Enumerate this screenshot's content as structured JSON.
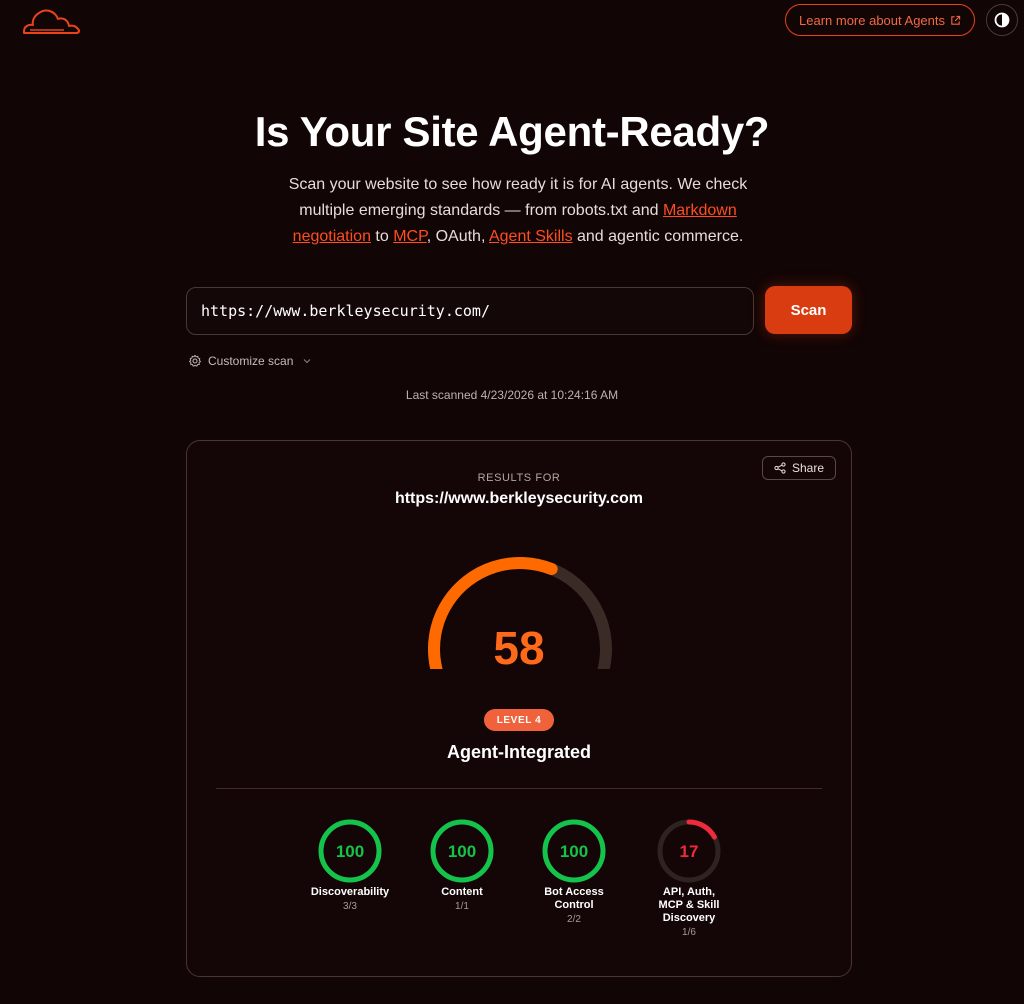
{
  "header": {
    "logo_icon": "cloudflare-cloud-icon",
    "learn_more_label": "Learn more about Agents",
    "external_icon": "external-link-icon",
    "theme_icon": "contrast-icon"
  },
  "hero": {
    "title": "Is Your Site Agent-Ready?",
    "subtitle_part1": "Scan your website to see how ready it is for AI agents. We check multiple emerging standards — from robots.txt and ",
    "link_markdown": "Markdown negotiation",
    "subtitle_part2": " to ",
    "link_mcp": "MCP",
    "subtitle_part3": ", OAuth, ",
    "link_skills": "Agent Skills",
    "subtitle_part4": " and agentic commerce."
  },
  "scan": {
    "url_value": "https://www.berkleysecurity.com/",
    "scan_label": "Scan",
    "customize_label": "Customize scan",
    "last_scanned": "Last scanned 4/23/2026 at 10:24:16 AM"
  },
  "results": {
    "share_label": "Share",
    "results_for_label": "RESULTS FOR",
    "url": "https://www.berkleysecurity.com",
    "score": 58,
    "score_max": 100,
    "level_badge": "LEVEL 4",
    "level_name": "Agent-Integrated",
    "metrics": [
      {
        "score": "100",
        "value": 1.0,
        "label": "Discoverability",
        "sub": "3/3",
        "color": "#14c44a"
      },
      {
        "score": "100",
        "value": 1.0,
        "label": "Content",
        "sub": "1/1",
        "color": "#14c44a"
      },
      {
        "score": "100",
        "value": 1.0,
        "label": "Bot Access Control",
        "sub": "2/2",
        "color": "#14c44a"
      },
      {
        "score": "17",
        "value": 0.17,
        "label": "API, Auth, MCP & Skill Discovery",
        "sub": "1/6",
        "color": "#ee2b3b"
      }
    ]
  },
  "colors": {
    "accent": "#e8431a",
    "gauge": "#ff6a00",
    "track": "#3a2b27",
    "pass": "#14c44a",
    "fail": "#ee2b3b"
  }
}
